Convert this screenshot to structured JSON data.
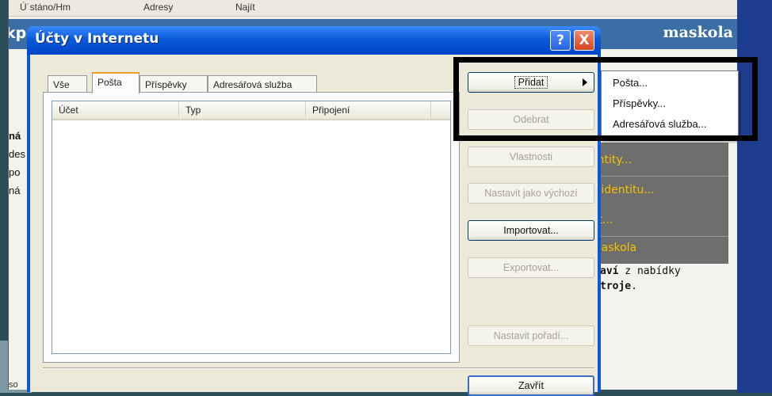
{
  "background": {
    "menubar": [
      "Ú˙stáno/Hm",
      "Adresy",
      "Najít"
    ],
    "header_left": "kp",
    "header_right": "maskola",
    "left_lines": [
      "ná",
      "des",
      "po",
      "ná"
    ],
    "panel_items": [
      "entity...",
      "u identitu...",
      "tit...",
      "maskola"
    ],
    "text_line1_bold": "aví",
    "text_line1_rest": " z nabídky",
    "text_line2_bold": "troje",
    "text_line2_rest": ".",
    "bottom": "so"
  },
  "dialog": {
    "title": "Účty v Internetu",
    "help": "?",
    "close": "X",
    "tabs": [
      "Vše",
      "Pošta",
      "Příspěvky",
      "Adresářová služba"
    ],
    "columns": [
      "Účet",
      "Typ",
      "Připojení"
    ],
    "buttons": {
      "add": "Přidat",
      "remove": "Odebrat",
      "properties": "Vlastnosti",
      "set_default": "Nastavit jako výchozí",
      "import": "Importovat...",
      "export": "Exportovat...",
      "order": "Nastavit pořadí...",
      "close": "Zavřít"
    }
  },
  "menu": {
    "items": [
      "Pošta...",
      "Příspěvky...",
      "Adresářová služba..."
    ]
  }
}
